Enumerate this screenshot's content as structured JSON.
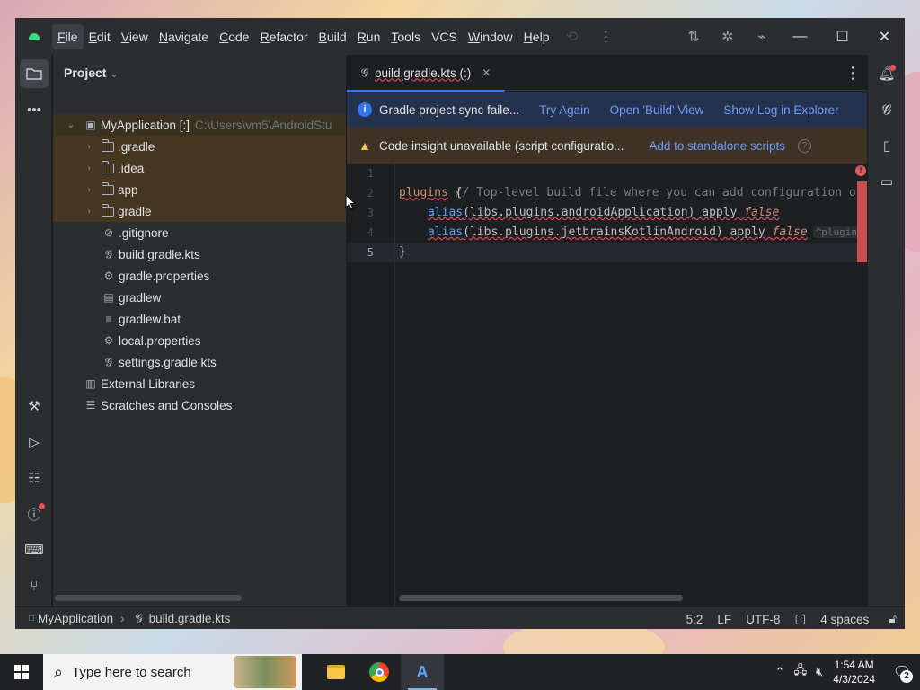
{
  "window": {
    "menu": [
      "File",
      "Edit",
      "View",
      "Navigate",
      "Code",
      "Refactor",
      "Build",
      "Run",
      "Tools",
      "VCS",
      "Window",
      "Help"
    ],
    "menu_mnemonics": [
      "F",
      "E",
      "V",
      "N",
      "C",
      "R",
      "B",
      "R",
      "T",
      "",
      "W",
      "H"
    ]
  },
  "project_panel": {
    "title": "Project",
    "root": {
      "label": "MyApplication [:]",
      "path": "C:\\Users\\vm5\\AndroidStu"
    },
    "items": [
      {
        "label": ".gradle",
        "type": "folder",
        "expandable": true
      },
      {
        "label": ".idea",
        "type": "folder",
        "expandable": true
      },
      {
        "label": "app",
        "type": "folder",
        "expandable": true
      },
      {
        "label": "gradle",
        "type": "folder",
        "expandable": true
      },
      {
        "label": ".gitignore",
        "type": "ignore-file"
      },
      {
        "label": "build.gradle.kts",
        "type": "gradle-file"
      },
      {
        "label": "gradle.properties",
        "type": "settings-file"
      },
      {
        "label": "gradlew",
        "type": "terminal-file"
      },
      {
        "label": "gradlew.bat",
        "type": "text-file"
      },
      {
        "label": "local.properties",
        "type": "settings-file"
      },
      {
        "label": "settings.gradle.kts",
        "type": "gradle-file"
      }
    ],
    "external_libraries": "External Libraries",
    "scratches": "Scratches and Consoles"
  },
  "editor": {
    "tab_label": "build.gradle.kts (:)",
    "sync_banner": {
      "message": "Gradle project sync faile...",
      "try_again": "Try Again",
      "open_build": "Open 'Build' View",
      "show_log": "Show Log in Explorer"
    },
    "insight_banner": {
      "message": "Code insight unavailable (script configuratio...",
      "add_link": "Add to standalone scripts",
      "help": "?"
    },
    "line_numbers": [
      "1",
      "2",
      "3",
      "4",
      "5"
    ],
    "code": {
      "line1": "// Top-level build file where you can add configuration options",
      "line2_kw": "plugins",
      "line2_brace": " {",
      "line3_fn": "alias",
      "line3_rest": "(libs.plugins.androidApplication) apply ",
      "line3_false": "false",
      "line4_fn": "alias",
      "line4_rest": "(libs.plugins.jetbrainsKotlinAndroid) apply ",
      "line4_false": "false",
      "line4_hint": "^plugin",
      "line5": "}"
    }
  },
  "status_bar": {
    "breadcrumb_project": "MyApplication",
    "breadcrumb_file": "build.gradle.kts",
    "position": "5:2",
    "line_ending": "LF",
    "encoding": "UTF-8",
    "indent": "4 spaces"
  },
  "taskbar": {
    "search_placeholder": "Type here to search",
    "time": "1:54 AM",
    "date": "4/3/2024",
    "notification_count": "2"
  },
  "colors": {
    "accent": "#3574f0",
    "error": "#f75464",
    "keyword": "#cf8e6d",
    "function": "#56a8f5",
    "comment": "#7a7e85"
  }
}
